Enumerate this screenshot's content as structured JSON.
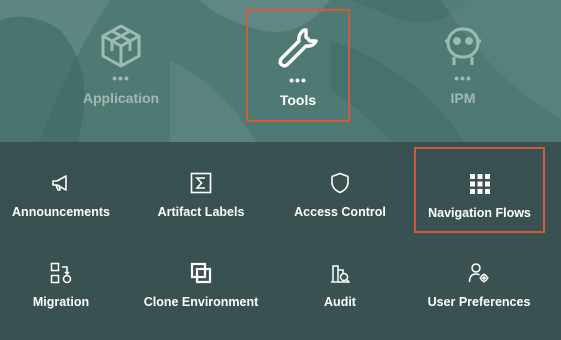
{
  "top_nav": {
    "items": [
      {
        "label": "Application",
        "icon": "cube-icon",
        "state": "inactive"
      },
      {
        "label": "Tools",
        "icon": "wrench-icon",
        "state": "selected"
      },
      {
        "label": "IPM",
        "icon": "robot-icon",
        "state": "inactive"
      }
    ],
    "more_glyph": "•••"
  },
  "tools_panel": {
    "row1": [
      {
        "label": "Announcements",
        "icon": "megaphone-icon"
      },
      {
        "label": "Artifact Labels",
        "icon": "sigma-icon"
      },
      {
        "label": "Access Control",
        "icon": "shield-icon"
      },
      {
        "label": "Navigation Flows",
        "icon": "grid-icon",
        "highlighted": true
      }
    ],
    "row2": [
      {
        "label": "Migration",
        "icon": "migration-icon"
      },
      {
        "label": "Clone Environment",
        "icon": "clone-icon"
      },
      {
        "label": "Audit",
        "icon": "audit-icon"
      },
      {
        "label": "User Preferences",
        "icon": "user-gear-icon"
      }
    ]
  },
  "colors": {
    "highlight_border": "#cf5b3a",
    "panel_bg": "#384e4f",
    "text": "#ffffff"
  }
}
